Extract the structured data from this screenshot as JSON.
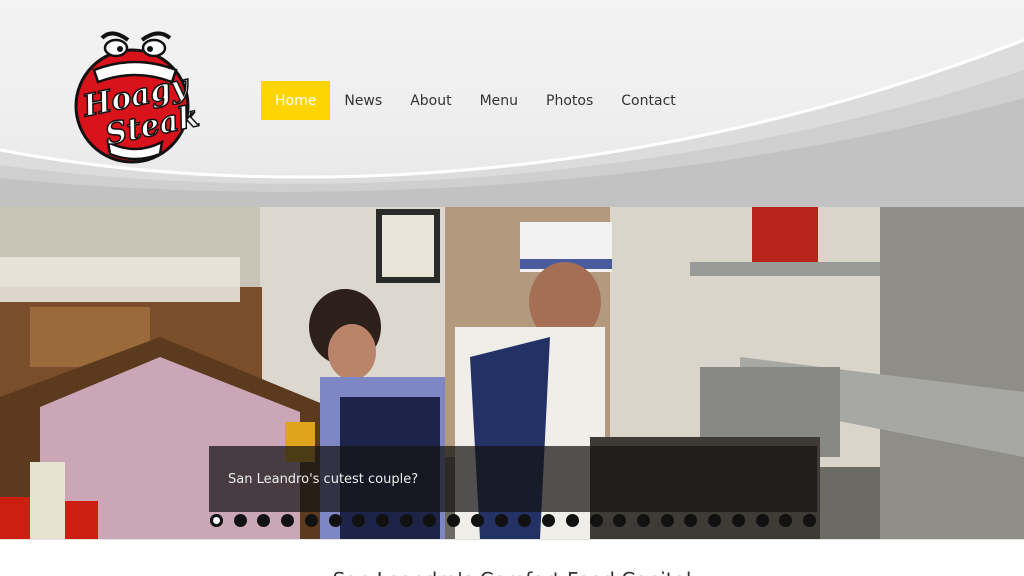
{
  "brand": {
    "logo_text_1": "Hoagy",
    "logo_text_2": "Steak"
  },
  "nav": {
    "items": [
      {
        "label": "Home",
        "active": true
      },
      {
        "label": "News"
      },
      {
        "label": "About"
      },
      {
        "label": "Menu"
      },
      {
        "label": "Photos"
      },
      {
        "label": "Contact"
      }
    ]
  },
  "slider": {
    "caption": "San Leandro's cutest couple?",
    "slide_count": 26,
    "active_index": 0
  },
  "main": {
    "tagline": "San Leandro's Comfort Food Capital"
  },
  "colors": {
    "accent": "#ffd400",
    "logo_red": "#d8131b"
  }
}
